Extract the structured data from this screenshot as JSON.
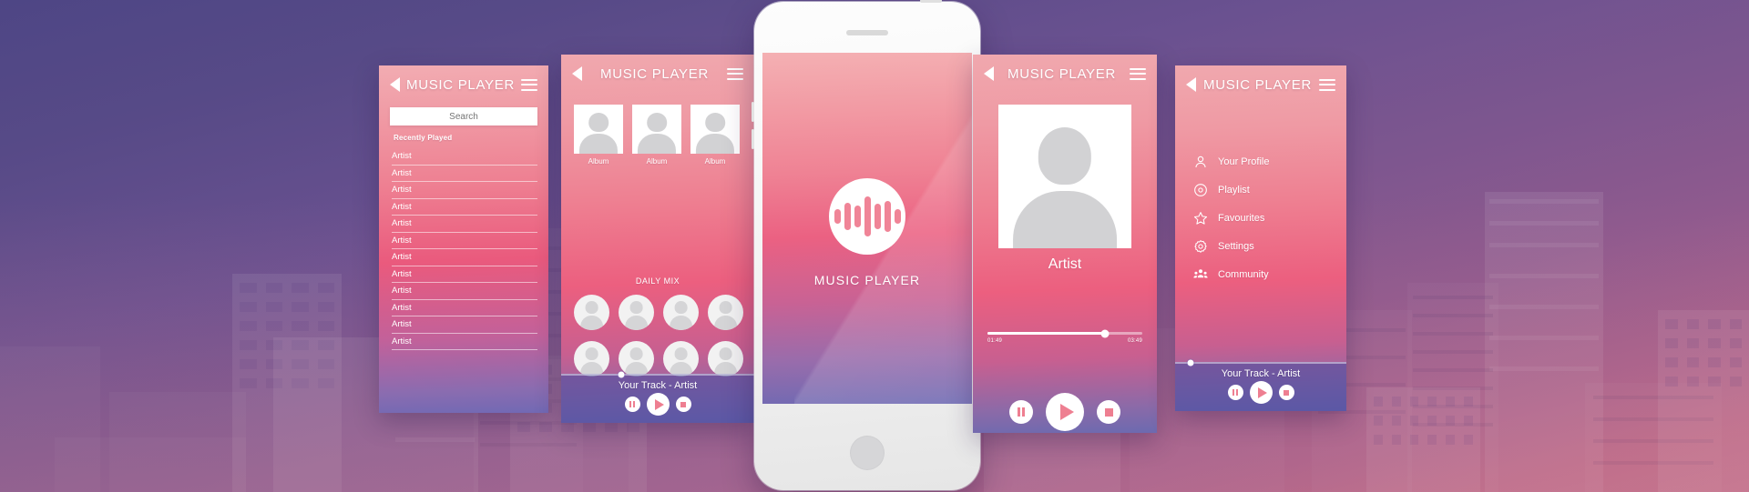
{
  "background": {
    "style": "purple-pink-gradient-cityscape",
    "sky_top_color": "#4e4685",
    "sky_bottom_color": "#c4718b"
  },
  "brand": {
    "app_name": "MUSIC PLAYER",
    "accent_color": "#ee7f91",
    "logo_icon": "music-waveform-icon"
  },
  "screens": {
    "library": {
      "title": "MUSIC PLAYER",
      "back_icon": "back-arrow-icon",
      "menu_icon": "hamburger-icon",
      "search": {
        "value": "",
        "placeholder": "Search",
        "icon": "search-input"
      },
      "section_label": "Recently Played",
      "artists": [
        "Artist",
        "Artist",
        "Artist",
        "Artist",
        "Artist",
        "Artist",
        "Artist",
        "Artist",
        "Artist",
        "Artist",
        "Artist",
        "Artist"
      ]
    },
    "browse": {
      "title": "MUSIC PLAYER",
      "back_icon": "back-arrow-icon",
      "menu_icon": "hamburger-icon",
      "albums": [
        {
          "caption": "Album"
        },
        {
          "caption": "Album"
        },
        {
          "caption": "Album"
        }
      ],
      "mix_title": "DAILY MIX",
      "mix_count": 8,
      "player": {
        "track": "Your Track - Artist",
        "progress_percent": 31,
        "pause_icon": "pause-icon",
        "play_icon": "play-icon",
        "stop_icon": "stop-icon"
      }
    },
    "splash": {
      "brand_text": "MUSIC PLAYER",
      "logo_icon": "music-waveform-icon",
      "speaker_icon": "earpiece-speaker",
      "home_icon": "home-button"
    },
    "now_playing": {
      "title": "MUSIC PLAYER",
      "back_icon": "back-arrow-icon",
      "menu_icon": "hamburger-icon",
      "artist": "Artist",
      "artwork_icon": "artist-photo-placeholder",
      "elapsed_time": "01:49",
      "total_time": "03:49",
      "progress_percent": 76,
      "pause_icon": "pause-icon",
      "play_icon": "play-icon",
      "stop_icon": "stop-icon"
    },
    "menu": {
      "title": "MUSIC PLAYER",
      "back_icon": "back-arrow-icon",
      "menu_icon": "hamburger-icon",
      "items": [
        {
          "label": "Your Profile",
          "icon": "user-icon"
        },
        {
          "label": "Playlist",
          "icon": "disc-icon"
        },
        {
          "label": "Favourites",
          "icon": "star-icon"
        },
        {
          "label": "Settings",
          "icon": "gear-icon"
        },
        {
          "label": "Community",
          "icon": "people-group-icon"
        }
      ],
      "player": {
        "track": "Your Track - Artist",
        "progress_percent": 9,
        "pause_icon": "pause-icon",
        "play_icon": "play-icon",
        "stop_icon": "stop-icon"
      }
    }
  }
}
